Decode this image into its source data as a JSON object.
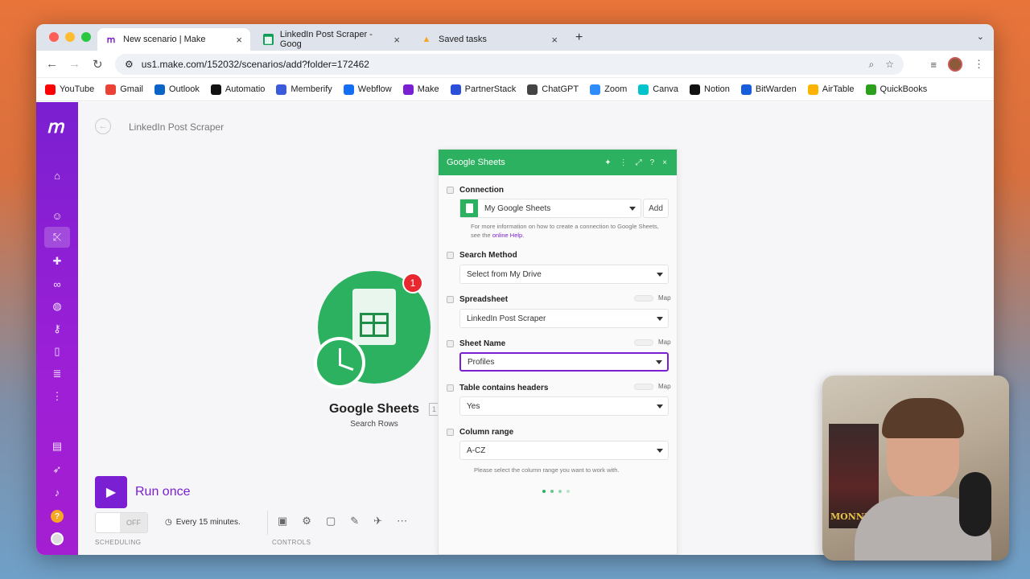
{
  "browser": {
    "tabs": [
      {
        "title": "New scenario | Make",
        "active": true
      },
      {
        "title": "LinkedIn Post Scraper - Goog",
        "active": false
      },
      {
        "title": "Saved tasks",
        "active": false
      }
    ],
    "url": "us1.make.com/152032/scenarios/add?folder=172462",
    "bookmarks": [
      {
        "label": "YouTube",
        "color": "#ff0000"
      },
      {
        "label": "Gmail",
        "color": "#ea4335"
      },
      {
        "label": "Outlook",
        "color": "#0a64c8"
      },
      {
        "label": "Automatio",
        "color": "#111111"
      },
      {
        "label": "Memberify",
        "color": "#3b5bdb"
      },
      {
        "label": "Webflow",
        "color": "#146ef5"
      },
      {
        "label": "Make",
        "color": "#7a1fd1"
      },
      {
        "label": "PartnerStack",
        "color": "#2b4fd6"
      },
      {
        "label": "ChatGPT",
        "color": "#444444"
      },
      {
        "label": "Zoom",
        "color": "#2d8cff"
      },
      {
        "label": "Canva",
        "color": "#00c4cc"
      },
      {
        "label": "Notion",
        "color": "#111111"
      },
      {
        "label": "BitWarden",
        "color": "#175ddc"
      },
      {
        "label": "AirTable",
        "color": "#fcb400"
      },
      {
        "label": "QuickBooks",
        "color": "#2ca01c"
      }
    ]
  },
  "scenario": {
    "title": "LinkedIn Post Scraper"
  },
  "module": {
    "name": "Google Sheets",
    "subtitle": "Search Rows",
    "badge": "1",
    "tag": "1"
  },
  "controls": {
    "run_label": "Run once",
    "toggle_label": "OFF",
    "schedule": "Every 15 minutes.",
    "scheduling_label": "SCHEDULING",
    "controls_label": "CONTROLS"
  },
  "panel": {
    "title": "Google Sheets",
    "connection": {
      "label": "Connection",
      "value": "My Google Sheets",
      "add_label": "Add",
      "hint_prefix": "For more information on how to create a connection to Google Sheets, see the",
      "hint_link": "online Help",
      "hint_suffix": "."
    },
    "search_method": {
      "label": "Search Method",
      "value": "Select from My Drive"
    },
    "spreadsheet": {
      "label": "Spreadsheet",
      "value": "LinkedIn Post Scraper",
      "map": "Map"
    },
    "sheet_name": {
      "label": "Sheet Name",
      "value": "Profiles",
      "map": "Map"
    },
    "table_headers": {
      "label": "Table contains headers",
      "value": "Yes",
      "map": "Map"
    },
    "column_range": {
      "label": "Column range",
      "value": "A-CZ",
      "hint": "Please select the column range you want to work with."
    }
  },
  "webcam": {
    "poster_text": "MONNET"
  },
  "colors": {
    "make_purple": "#7a1fd1",
    "sheets_green": "#2bb15f",
    "badge_red": "#e8282e"
  }
}
